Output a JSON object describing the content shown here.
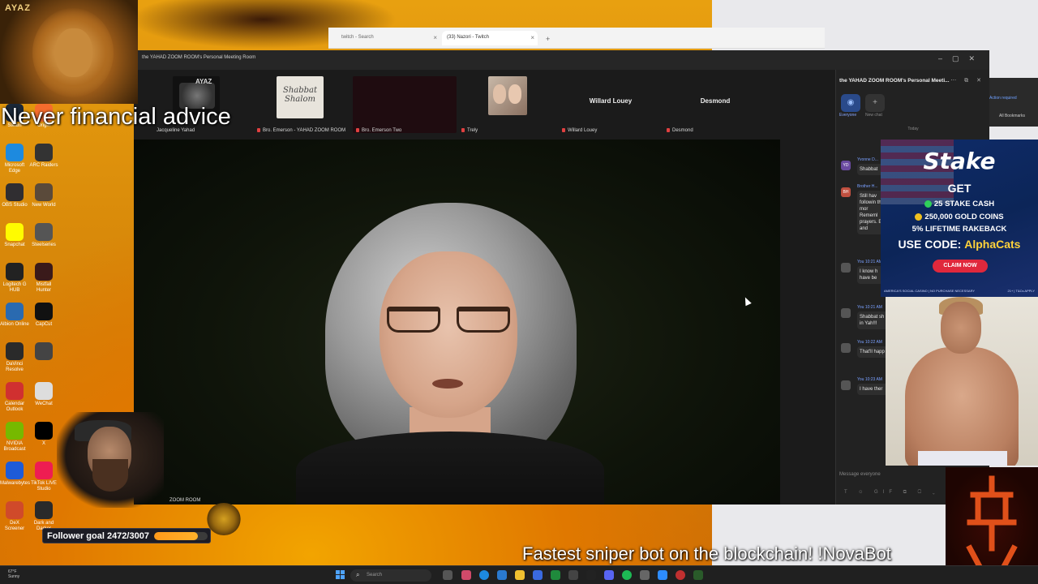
{
  "overlays": {
    "top_left_tag": "AYAZ",
    "never_text": "Never financial advice",
    "sniper_text": "Fastest sniper bot on the blockchain! !NovaBot",
    "follower_label": "Follower goal 2472/3007",
    "follower_progress": 0.822
  },
  "browser": {
    "tabs": [
      {
        "label": "twitch - Search",
        "close": "×"
      },
      {
        "label": "(33) Nazori - Twitch",
        "close": "×"
      }
    ],
    "new_tab": "+",
    "action_required": "Action required",
    "all_bookmarks": "All Bookmarks"
  },
  "zoom": {
    "window_title": "the YAHAD ZOOM ROOM's Personal Meeting Room",
    "participants": [
      {
        "label": "Bro. Emerson - YAHAD ZOOM ROOM",
        "tile_text": "Shabbat Shalom"
      },
      {
        "label": "Bro. Emerson Two"
      },
      {
        "label": "Trely"
      },
      {
        "label": "Willard Louey",
        "big_name": "Willard Louey"
      },
      {
        "label": "Desmond",
        "big_name": "Desmond"
      }
    ],
    "first_tile_label": "Jacqueline Yahad",
    "first_tile_logo": "AYAZ",
    "main_video_label": "ZOOM ROOM"
  },
  "chat": {
    "title": "the YAHAD ZOOM ROOM's Personal Meeti...",
    "tab_everyone": "Everyone",
    "tab_new_chat": "New chat",
    "day_label": "Today",
    "messages": [
      {
        "initials": "YD",
        "who": "Yvonne D...",
        "text": "Shabbat"
      },
      {
        "initials": "BH",
        "who": "Brother H...",
        "text": "Still hav followin this mor Rememl prayers. Elie and"
      },
      {
        "initials": "",
        "who": "You 10:21 AM",
        "text": "I know h have be"
      },
      {
        "initials": "",
        "who": "You 10:21 AM",
        "text": "Shabbat sh in Yah!!!"
      },
      {
        "initials": "",
        "who": "You 10:22 AM",
        "text": "That'll happ"
      },
      {
        "initials": "",
        "who": "You 10:23 AM",
        "text": "I have ther"
      }
    ],
    "input_placeholder": "Message everyone"
  },
  "ad": {
    "brand": "Stake",
    "get": "GET",
    "line1": "25 STAKE CASH",
    "line2": "250,000 GOLD COINS",
    "line3": "5% LIFETIME RAKEBACK",
    "code_prefix": "USE CODE: ",
    "code": "AlphaCats",
    "cta": "CLAIM NOW",
    "fine_left": "AMERICA'S SOCIAL CASINO | NO PURCHASE NECESSARY",
    "fine_right": "21+ | T&Cs APPLY"
  },
  "desktop_icons": [
    {
      "label": "Steam",
      "color": "#1b2838"
    },
    {
      "label": "Origin",
      "color": "#f56c2d"
    },
    {
      "label": "Microsoft Edge",
      "color": "#1d8adf"
    },
    {
      "label": "ARC Raiders",
      "color": "#333333"
    },
    {
      "label": "OBS Studio",
      "color": "#302e31"
    },
    {
      "label": "New World",
      "color": "#5a4a3a"
    },
    {
      "label": "Snapchat",
      "color": "#fffc00"
    },
    {
      "label": "Steelseries",
      "color": "#555555"
    },
    {
      "label": "Logitech G HUB",
      "color": "#222222"
    },
    {
      "label": "Mistfall Hunter",
      "color": "#3a1a1a"
    },
    {
      "label": "Albion Online",
      "color": "#2a6ab0"
    },
    {
      "label": "CapCut",
      "color": "#111111"
    },
    {
      "label": "DaVinci Resolve",
      "color": "#2a2a2a"
    },
    {
      "label": "",
      "color": "#444444"
    },
    {
      "label": "Calendar Outlook",
      "color": "#d03030"
    },
    {
      "label": "WeChat",
      "color": "#dddddd"
    },
    {
      "label": "NVIDIA Broadcast",
      "color": "#76b900"
    },
    {
      "label": "X",
      "color": "#000000"
    },
    {
      "label": "Malwarebytes",
      "color": "#1e5bd8"
    },
    {
      "label": "TikTok LIVE Studio",
      "color": "#ee1d52"
    },
    {
      "label": "DeX Screener",
      "color": "#d04a2a"
    },
    {
      "label": "Dark and Darker",
      "color": "#2a2a2a"
    }
  ],
  "taskbar": {
    "weather_temp": "67°F",
    "weather_desc": "Sunny",
    "search_placeholder": "Search"
  },
  "colors": {
    "zoom_bg": "#1b1b1b",
    "accent_blue": "#4ea3ff",
    "stake_blue": "#0f2c6a",
    "code_yellow": "#ffd23a",
    "follower_orange": "#ff9a1a"
  }
}
